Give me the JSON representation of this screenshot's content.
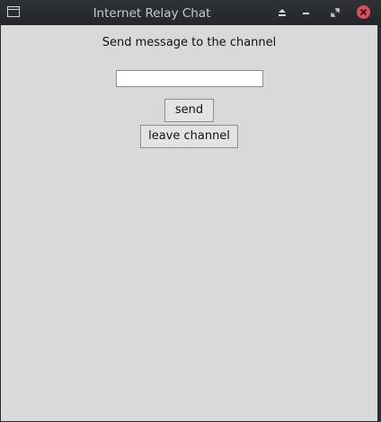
{
  "window": {
    "title": "Internet Relay Chat",
    "controls": {
      "eject_icon": "eject-icon",
      "minimize_icon": "minimize-icon",
      "restore_icon": "restore-icon",
      "close_icon": "close-icon"
    },
    "close_color": "#d9525a"
  },
  "main": {
    "prompt": "Send message to the channel",
    "message_input": {
      "value": "",
      "placeholder": ""
    },
    "send_label": "send",
    "leave_label": "leave channel"
  }
}
